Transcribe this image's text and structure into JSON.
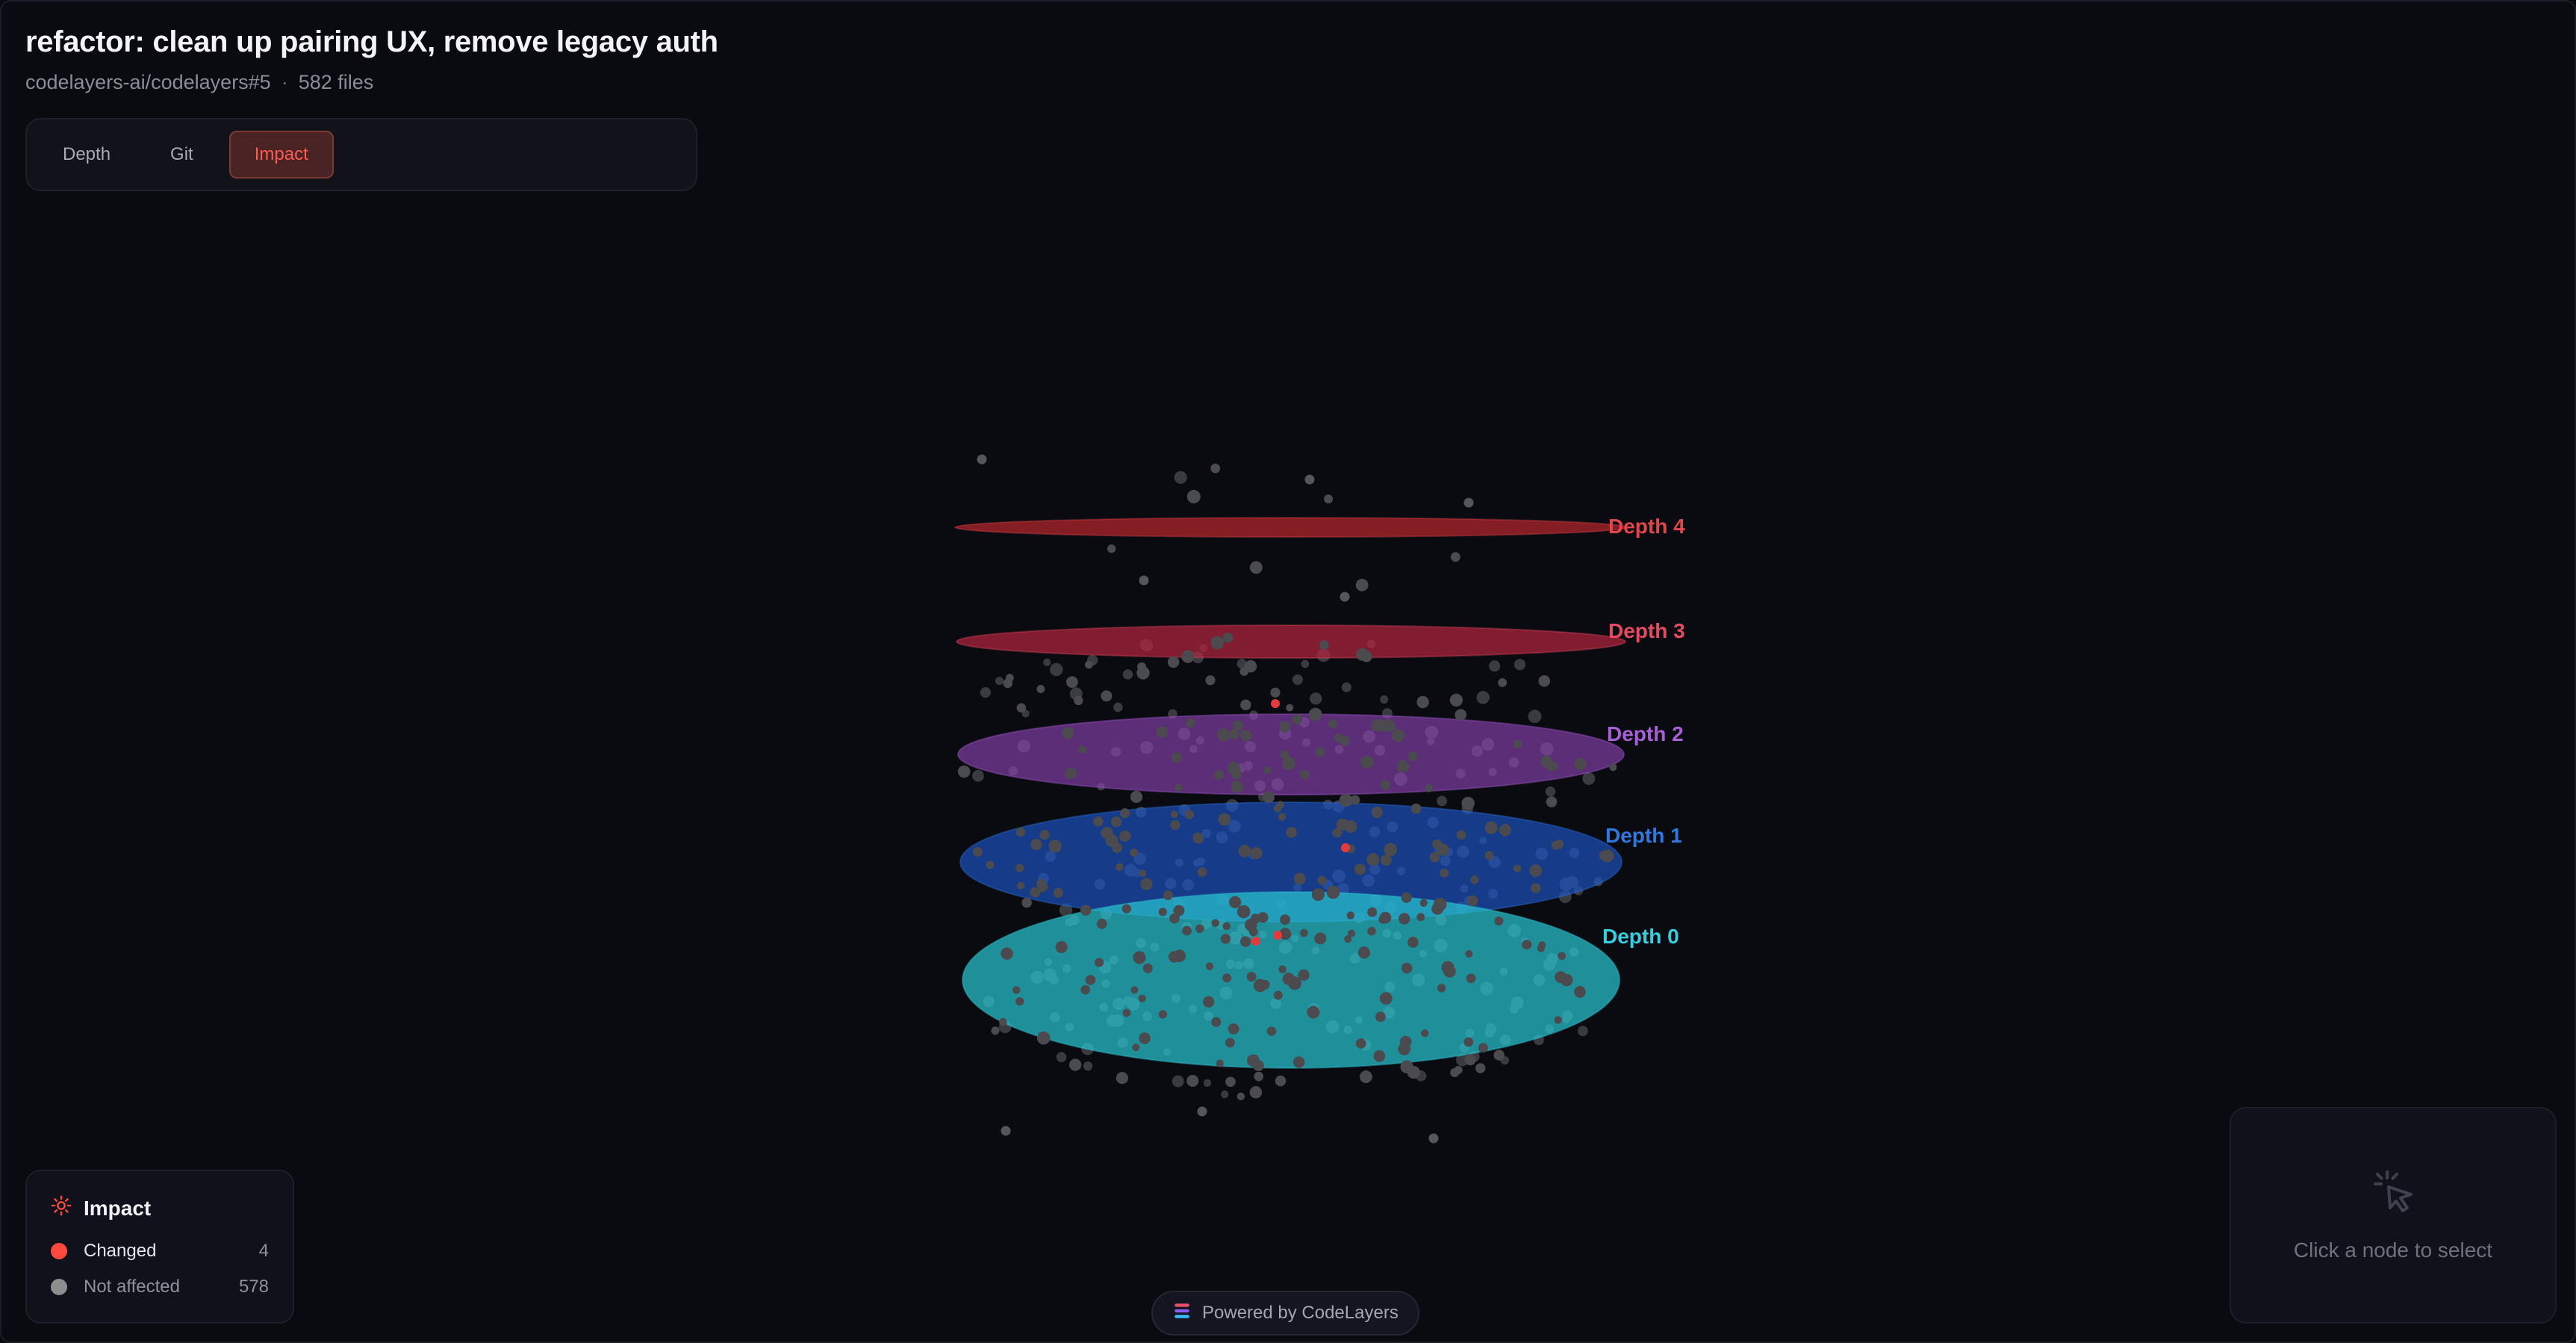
{
  "header": {
    "title": "refactor: clean up pairing UX, remove legacy auth",
    "repo": "codelayers-ai/codelayers#5",
    "separator": "·",
    "file_count": "582 files"
  },
  "modes": [
    {
      "label": "Depth",
      "active": false
    },
    {
      "label": "Git",
      "active": false
    },
    {
      "label": "Impact",
      "active": true
    }
  ],
  "layers": [
    {
      "label": "Depth 4",
      "color": "#e0464b"
    },
    {
      "label": "Depth 3",
      "color": "#e54a62"
    },
    {
      "label": "Depth 2",
      "color": "#a95fd6"
    },
    {
      "label": "Depth 1",
      "color": "#2f78e0"
    },
    {
      "label": "Depth 0",
      "color": "#35cfe0"
    }
  ],
  "legend": {
    "title": "Impact",
    "icon": "sun-icon",
    "items": [
      {
        "label": "Changed",
        "count": "4",
        "color": "#ff4a3d"
      },
      {
        "label": "Not affected",
        "count": "578",
        "color": "#8e8e8e"
      }
    ]
  },
  "selection": {
    "icon": "pointer-click-icon",
    "hint": "Click a node to select"
  },
  "footer": {
    "icon": "codelayers-logo-icon",
    "text": "Powered by CodeLayers"
  }
}
